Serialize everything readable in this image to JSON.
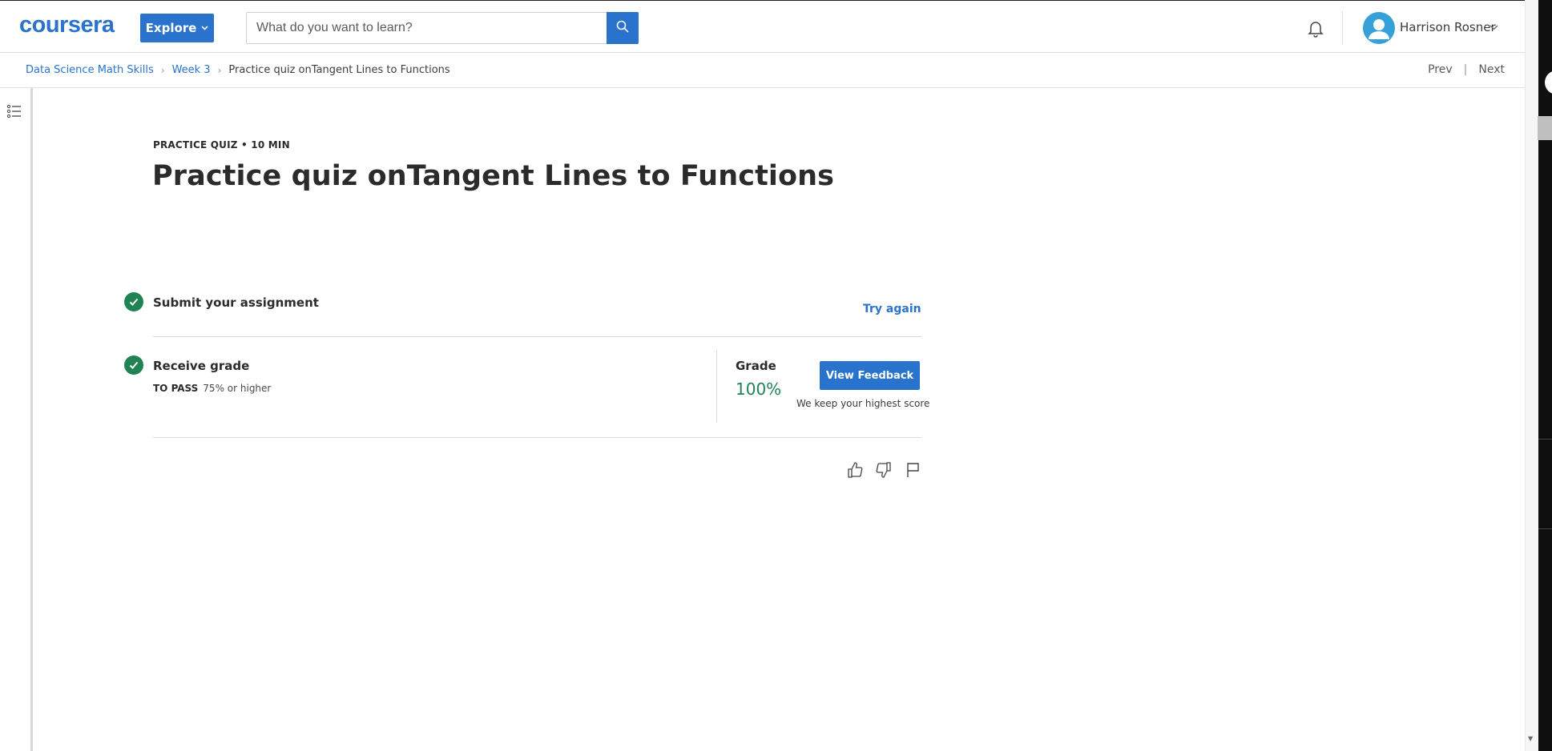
{
  "header": {
    "logo": "coursera",
    "explore_label": "Explore",
    "search_placeholder": "What do you want to learn?",
    "user_name": "Harrison Rosner"
  },
  "breadcrumb": {
    "items": [
      "Data Science Math Skills",
      "Week 3",
      "Practice quiz onTangent Lines to Functions"
    ],
    "prev": "Prev",
    "next": "Next",
    "separator": "|"
  },
  "quiz": {
    "kicker": "PRACTICE QUIZ • 10 MIN",
    "title": "Practice quiz onTangent Lines to Functions",
    "steps": {
      "submit": {
        "title": "Submit your assignment",
        "action": "Try again"
      },
      "grade": {
        "title": "Receive grade",
        "to_pass_label": "TO PASS",
        "to_pass_value": "75% or higher",
        "grade_label": "Grade",
        "grade_value": "100%",
        "feedback_button": "View Feedback",
        "keep_note": "We keep your highest score"
      }
    }
  },
  "colors": {
    "brand_blue": "#2a73cc",
    "success_green": "#1f8354"
  },
  "icons": [
    "search-icon",
    "bell-icon",
    "avatar-icon",
    "chevron-down-icon",
    "course-outline-icon",
    "check-icon",
    "thumbs-up-icon",
    "thumbs-down-icon",
    "flag-icon"
  ]
}
